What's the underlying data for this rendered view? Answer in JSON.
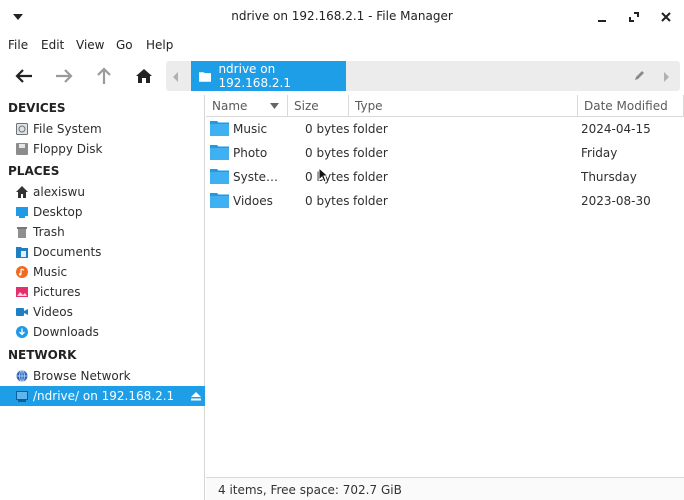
{
  "window": {
    "title": "ndrive on 192.168.2.1 - File Manager"
  },
  "menu": {
    "file": "File",
    "edit": "Edit",
    "view": "View",
    "go": "Go",
    "help": "Help"
  },
  "pathbar": {
    "crumb": "ndrive on 192.168.2.1"
  },
  "sidebar": {
    "devices_heading": "DEVICES",
    "devices": [
      {
        "label": "File System",
        "icon": "drive-icon"
      },
      {
        "label": "Floppy Disk",
        "icon": "floppy-icon"
      }
    ],
    "places_heading": "PLACES",
    "places": [
      {
        "label": "alexiswu",
        "icon": "home-icon"
      },
      {
        "label": "Desktop",
        "icon": "desktop-icon"
      },
      {
        "label": "Trash",
        "icon": "trash-icon"
      },
      {
        "label": "Documents",
        "icon": "documents-icon"
      },
      {
        "label": "Music",
        "icon": "music-icon"
      },
      {
        "label": "Pictures",
        "icon": "pictures-icon"
      },
      {
        "label": "Videos",
        "icon": "videos-icon"
      },
      {
        "label": "Downloads",
        "icon": "downloads-icon"
      }
    ],
    "network_heading": "NETWORK",
    "network": [
      {
        "label": "Browse Network",
        "icon": "network-icon"
      },
      {
        "label": "/ndrive/ on 192.168.2.1",
        "icon": "network-share-icon",
        "selected": true
      }
    ]
  },
  "columns": {
    "name": "Name",
    "size": "Size",
    "type": "Type",
    "modified": "Date Modified"
  },
  "files": [
    {
      "name": "Music",
      "size": "0 bytes",
      "type": "folder",
      "modified": "2024-04-15"
    },
    {
      "name": "Photo",
      "size": "0 bytes",
      "type": "folder",
      "modified": "Friday"
    },
    {
      "name": "Syste…",
      "size": "0 bytes",
      "type": "folder",
      "modified": "Thursday"
    },
    {
      "name": "Vidoes",
      "size": "0 bytes",
      "type": "folder",
      "modified": "2023-08-30"
    }
  ],
  "status": {
    "text": "4 items, Free space: 702.7 GiB"
  },
  "colors": {
    "accent": "#1f9ee8",
    "folder": "#1e9ae6"
  }
}
